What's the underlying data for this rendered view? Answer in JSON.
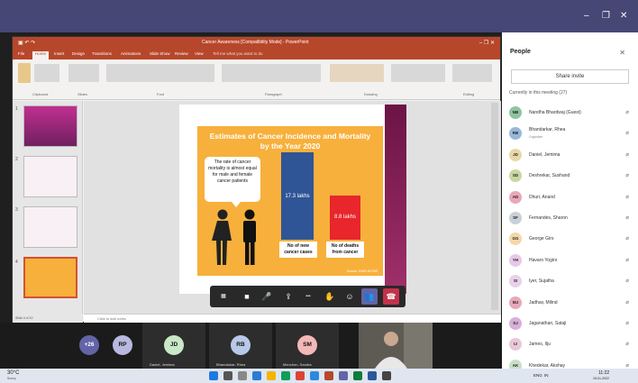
{
  "window": {
    "minimize": "–",
    "restore": "❐",
    "close": "✕"
  },
  "ppt": {
    "title": "Cancer Awareness [Compatibility Mode] - PowerPoint",
    "tabs": [
      "File",
      "Home",
      "Insert",
      "Design",
      "Transitions",
      "Animations",
      "Slide Show",
      "Review",
      "View"
    ],
    "tell_me": "Tell me what you want to do",
    "groups": [
      "Clipboard",
      "Slides",
      "Font",
      "Paragraph",
      "Drawing",
      "Editing"
    ],
    "notes_placeholder": "Click to add notes",
    "status_left": "Slide 4 of 10"
  },
  "thumbs": [
    "1",
    "2",
    "3",
    "4"
  ],
  "slide": {
    "title": "Estimates of Cancer Incidence and Mortality by the Year 2020",
    "bubble": "The rate of cancer mortality is almost equal for male and female cancer patients",
    "source": "Source: ICMR-NCDIR"
  },
  "chart_data": {
    "type": "bar",
    "categories": [
      "No of new cancer cases",
      "No of deaths from cancer"
    ],
    "values": [
      17.3,
      8.8
    ],
    "value_labels": [
      "17.3 lakhs",
      "8.8 lakhs"
    ],
    "colors": [
      "#2f5597",
      "#e8262b"
    ],
    "ylim": [
      0,
      20
    ]
  },
  "meeting_bar": {
    "grid": "▦",
    "video": "■",
    "mic": "🎤",
    "share": "⇪",
    "more": "•••",
    "raise": "✋",
    "react": "☺",
    "participants": "👥",
    "leave": "☎"
  },
  "people": {
    "title": "People",
    "close": "✕",
    "share_invite": "Share invite",
    "heading": "Currently in this meeting (27)",
    "list": [
      {
        "initials": "NB",
        "name": "Nandha Bhardwaj (Guest)",
        "sub": "",
        "color": "#8fc4a0"
      },
      {
        "initials": "RB",
        "name": "Bhandarkar, Rhea",
        "sub": "Organizer",
        "color": "#98b8d8"
      },
      {
        "initials": "JD",
        "name": "Daniel, Jemima",
        "sub": "",
        "color": "#e8d8a8"
      },
      {
        "initials": "SD",
        "name": "Deshrekar, Sushand",
        "sub": "",
        "color": "#c8d8a0"
      },
      {
        "initials": "AD",
        "name": "Dhuri, Anand",
        "sub": "",
        "color": "#e8a8b8"
      },
      {
        "initials": "SF",
        "name": "Fernandes, Sharon",
        "sub": "",
        "color": "#c8d0d8"
      },
      {
        "initials": "GG",
        "name": "George Giro",
        "sub": "",
        "color": "#f4d8a8"
      },
      {
        "initials": "YH",
        "name": "Havaro Yogini",
        "sub": "",
        "color": "#e8c8e8"
      },
      {
        "initials": "SI",
        "name": "Iyer, Sujatha",
        "sub": "",
        "color": "#e8d0e8"
      },
      {
        "initials": "MJ",
        "name": "Jadhav, Milind",
        "sub": "",
        "color": "#e8a8b8"
      },
      {
        "initials": "SJ",
        "name": "Jaganathan, Sataji",
        "sub": "",
        "color": "#d8b0d8"
      },
      {
        "initials": "IJ",
        "name": "James, Ilju",
        "sub": "",
        "color": "#e8c8d8"
      },
      {
        "initials": "AK",
        "name": "Khedekar, Akshay",
        "sub": "",
        "color": "#c8e0c8"
      }
    ]
  },
  "strip": {
    "overflow": "+26",
    "tiles": [
      {
        "initials": "RP",
        "color": "#b8b8e0",
        "name": ""
      },
      {
        "initials": "JD",
        "color": "#c8e8c8",
        "name": "Daniel, Jemima"
      },
      {
        "initials": "RB",
        "color": "#b8c8e8",
        "name": "Bhandarkar, Rhea"
      },
      {
        "initials": "SM",
        "color": "#f4b8b8",
        "name": "Menchon, Sandra"
      }
    ]
  },
  "taskbar": {
    "weather": "30°C",
    "weather_sub": "Sunny",
    "lang": "ENG",
    "region": "IN",
    "time": "11:22",
    "date": "15-01-2022"
  }
}
